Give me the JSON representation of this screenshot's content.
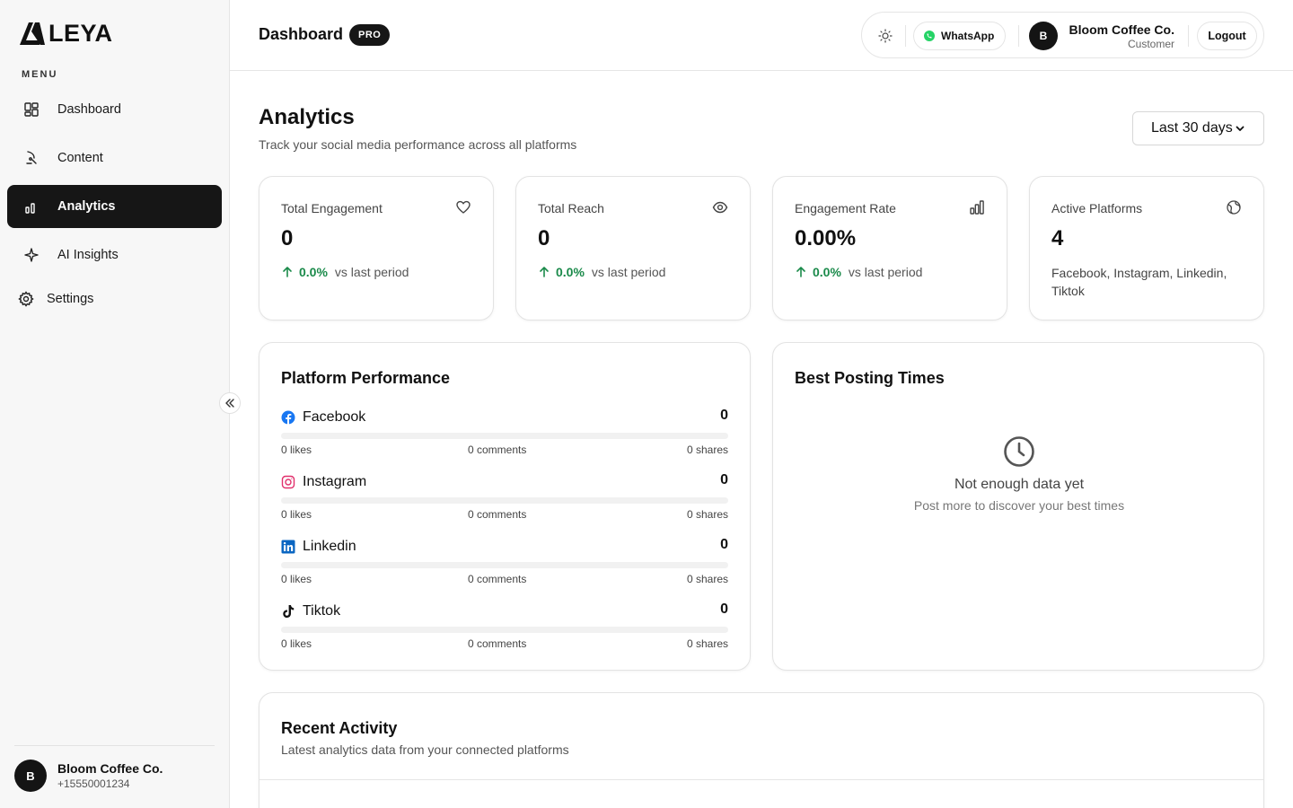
{
  "brand": {
    "name": "LEYA"
  },
  "sidebar": {
    "menu_label": "MENU",
    "items": [
      {
        "label": "Dashboard",
        "icon": "dashboard-icon",
        "active": false
      },
      {
        "label": "Content",
        "icon": "content-icon",
        "active": false
      },
      {
        "label": "Analytics",
        "icon": "analytics-icon",
        "active": true
      },
      {
        "label": "AI Insights",
        "icon": "sparkle-icon",
        "active": false
      },
      {
        "label": "Settings",
        "icon": "gear-icon",
        "active": false
      }
    ],
    "collapse_icon": "double-chevron-left-icon",
    "user": {
      "initial": "B",
      "name": "Bloom Coffee Co.",
      "phone": "+15550001234"
    }
  },
  "header": {
    "title": "Dashboard",
    "badge": "PRO",
    "theme_icon": "sun-icon",
    "whatsapp_label": "WhatsApp",
    "user": {
      "initial": "B",
      "name": "Bloom Coffee Co.",
      "role": "Customer"
    },
    "logout_label": "Logout"
  },
  "analytics": {
    "title": "Analytics",
    "subtitle": "Track your social media performance across all platforms",
    "range": {
      "selected": "Last 30 days"
    }
  },
  "stats": [
    {
      "label": "Total Engagement",
      "icon": "heart-icon",
      "value": "0",
      "change": "0.0%",
      "vs": "vs last period"
    },
    {
      "label": "Total Reach",
      "icon": "eye-icon",
      "value": "0",
      "change": "0.0%",
      "vs": "vs last period"
    },
    {
      "label": "Engagement Rate",
      "icon": "bar-chart-icon",
      "value": "0.00%",
      "change": "0.0%",
      "vs": "vs last period"
    },
    {
      "label": "Active Platforms",
      "icon": "globe-icon",
      "value": "4",
      "platforms": "Facebook, Instagram, Linkedin, Tiktok"
    }
  ],
  "platform_performance": {
    "title": "Platform Performance",
    "platforms": [
      {
        "name": "Facebook",
        "icon": "facebook-icon",
        "total": "0",
        "likes": "0 likes",
        "comments": "0 comments",
        "shares": "0 shares",
        "progress": 0
      },
      {
        "name": "Instagram",
        "icon": "instagram-icon",
        "total": "0",
        "likes": "0 likes",
        "comments": "0 comments",
        "shares": "0 shares",
        "progress": 0
      },
      {
        "name": "Linkedin",
        "icon": "linkedin-icon",
        "total": "0",
        "likes": "0 likes",
        "comments": "0 comments",
        "shares": "0 shares",
        "progress": 0
      },
      {
        "name": "Tiktok",
        "icon": "tiktok-icon",
        "total": "0",
        "likes": "0 likes",
        "comments": "0 comments",
        "shares": "0 shares",
        "progress": 0
      }
    ]
  },
  "best_posting_times": {
    "title": "Best Posting Times",
    "empty_icon": "clock-icon",
    "empty_message": "Not enough data yet",
    "empty_sub": "Post more to discover your best times"
  },
  "recent_activity": {
    "title": "Recent Activity",
    "subtitle": "Latest analytics data from your connected platforms"
  },
  "colors": {
    "accent": "#161616",
    "positive": "#1a8a4a",
    "facebook": "#1877f2",
    "instagram": "#e1306c",
    "linkedin": "#0a66c2",
    "whatsapp": "#25d366"
  }
}
